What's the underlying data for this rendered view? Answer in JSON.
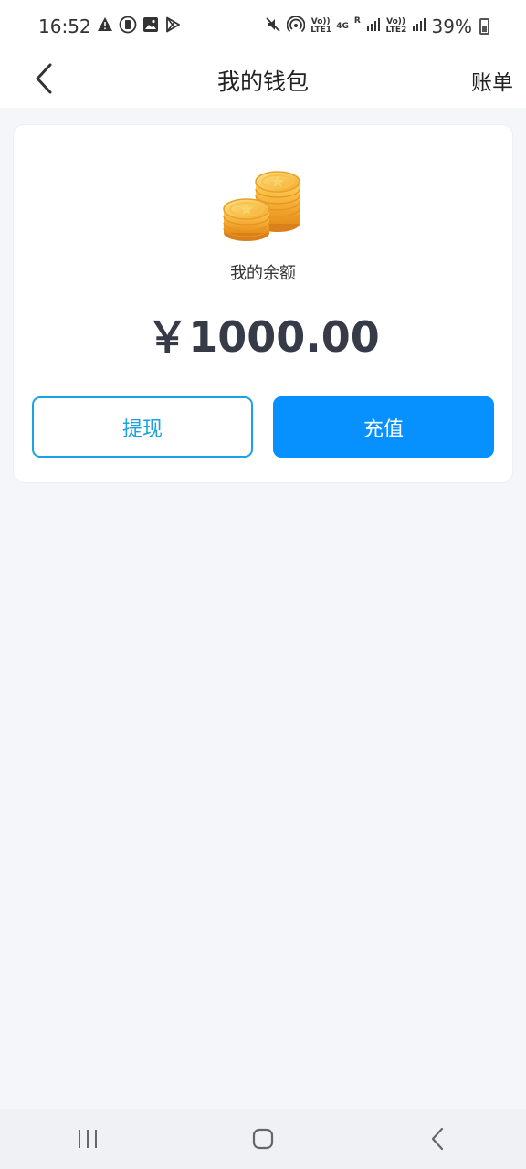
{
  "status_bar": {
    "time": "16:52",
    "battery_percent": "39%",
    "icons_left": [
      "warning-icon",
      "sim-icon",
      "image-icon",
      "play-store-icon"
    ],
    "icons_right": [
      "mute-icon",
      "hotspot-icon",
      "volte1-icon",
      "4g-icon",
      "signal1-icon",
      "volte2-icon",
      "signal2-icon",
      "battery-icon"
    ],
    "volte1_label": "Vo)) LTE1",
    "volte2_label": "Vo)) LTE2",
    "net_label": "4G",
    "roaming_label": "R"
  },
  "header": {
    "title": "我的钱包",
    "right_action": "账单"
  },
  "wallet": {
    "balance_label": "我的余额",
    "balance_amount": "￥1000.00",
    "withdraw_label": "提现",
    "recharge_label": "充值"
  },
  "colors": {
    "accent": "#0790ff",
    "withdraw_border": "#1aa3e0",
    "amount_text": "#363b47",
    "background": "#f4f6f9"
  }
}
